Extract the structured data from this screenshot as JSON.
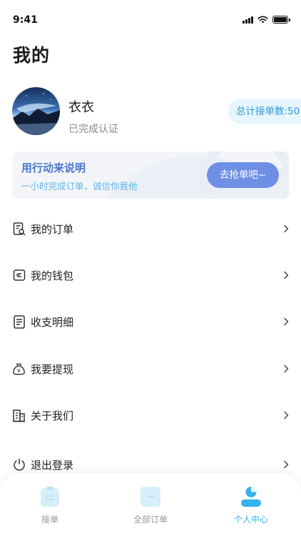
{
  "status_bar": {
    "time": "9:41"
  },
  "page": {
    "title": "我的"
  },
  "profile": {
    "name": "衣衣",
    "status": "已完成认证",
    "order_count": "总计接单数:50"
  },
  "banner": {
    "title": "用行动来说明",
    "subtitle": "一小时完成订单，诚信你我他",
    "button": "去抢单吧~"
  },
  "menu": [
    {
      "label": "我的订单",
      "icon": "order-search-icon"
    },
    {
      "label": "我的钱包",
      "icon": "wallet-icon"
    },
    {
      "label": "收支明细",
      "icon": "document-list-icon"
    },
    {
      "label": "我要提现",
      "icon": "money-bag-icon"
    },
    {
      "label": "关于我们",
      "icon": "building-icon"
    },
    {
      "label": "退出登录",
      "icon": "power-icon"
    }
  ],
  "tab_bar": {
    "tabs": [
      {
        "label": "接单",
        "icon": "clipboard-icon",
        "active": false
      },
      {
        "label": "全部订单",
        "icon": "orders-icon",
        "active": false
      },
      {
        "label": "个人中心",
        "icon": "person-icon",
        "active": true
      }
    ]
  },
  "colors": {
    "accent": "#36b3ec",
    "button": "#6f8fe6",
    "banner_title": "#4a78c9",
    "banner_subtitle": "#5fb4e6"
  }
}
